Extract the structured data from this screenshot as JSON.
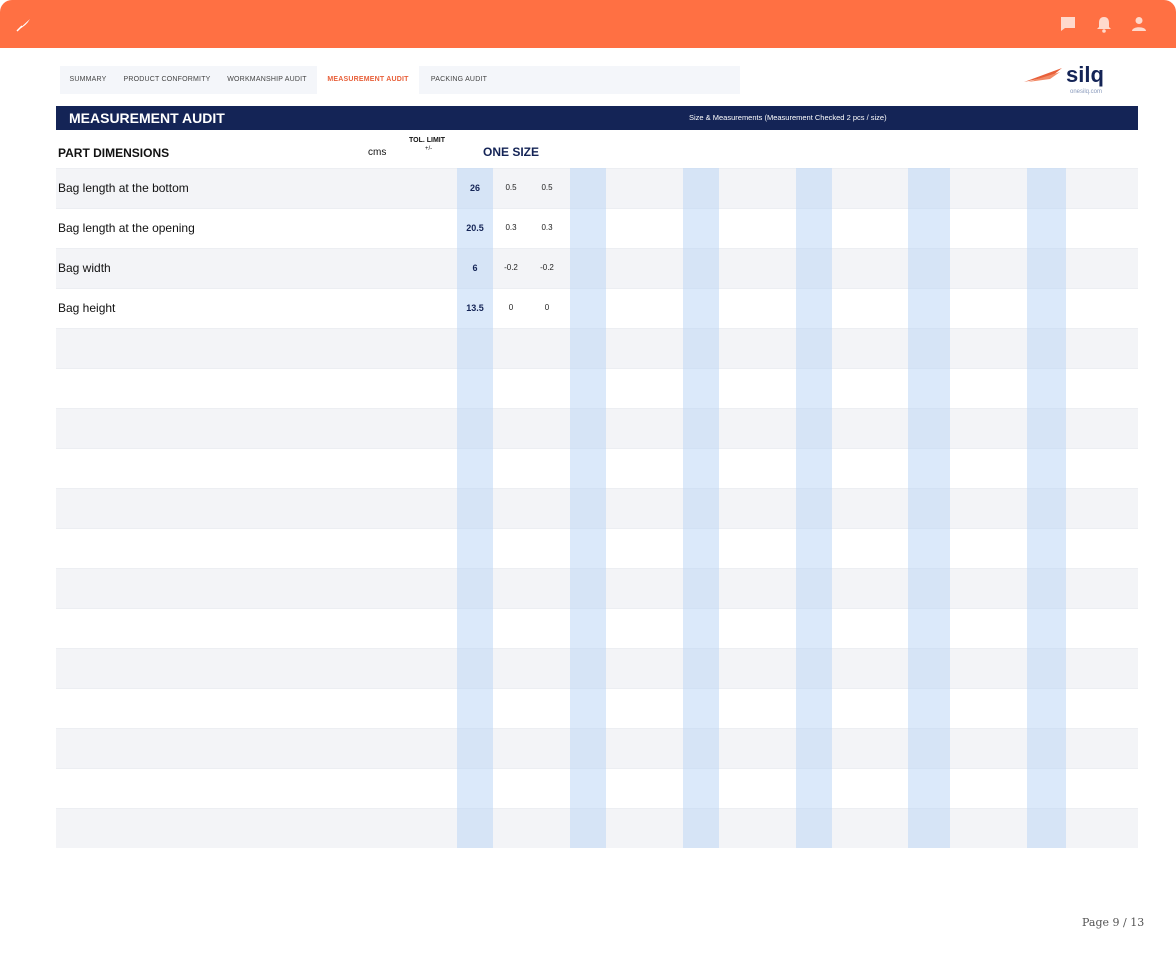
{
  "colors": {
    "topbar": "#ff7043",
    "banner": "#142456",
    "active_tab": "#e8603a",
    "size_column": "#dbe8f8"
  },
  "topbar": {
    "icons": [
      "feather-logo-icon",
      "chat-icon",
      "bell-icon",
      "user-icon"
    ]
  },
  "tabs": [
    {
      "label": "SUMMARY",
      "active": false
    },
    {
      "label": "PRODUCT CONFORMITY",
      "active": false
    },
    {
      "label": "WORKMANSHIP AUDIT",
      "active": false
    },
    {
      "label": "MEASUREMENT AUDIT",
      "active": true
    },
    {
      "label": "PACKING AUDIT",
      "active": false
    }
  ],
  "brand": {
    "name": "silq",
    "url": "onesilq.com"
  },
  "banner": {
    "title": "MEASUREMENT AUDIT",
    "subtitle": "Size & Measurements  (Measurement Checked 2 pcs / size)"
  },
  "table_header": {
    "part_dimensions": "PART DIMENSIONS",
    "unit": "cms",
    "tol_limit": "TOL. LIMIT",
    "tol_sign": "+/-",
    "size": "ONE SIZE"
  },
  "rows": [
    {
      "name": "Bag length at the bottom",
      "value": "26",
      "tol_plus": "0.5",
      "tol_minus": "0.5"
    },
    {
      "name": "Bag length at the opening",
      "value": "20.5",
      "tol_plus": "0.3",
      "tol_minus": "0.3"
    },
    {
      "name": "Bag width",
      "value": "6",
      "tol_plus": "-0.2",
      "tol_minus": "-0.2"
    },
    {
      "name": "Bag height",
      "value": "13.5",
      "tol_plus": "0",
      "tol_minus": "0"
    }
  ],
  "footer": {
    "page": "Page 9 / 13"
  }
}
